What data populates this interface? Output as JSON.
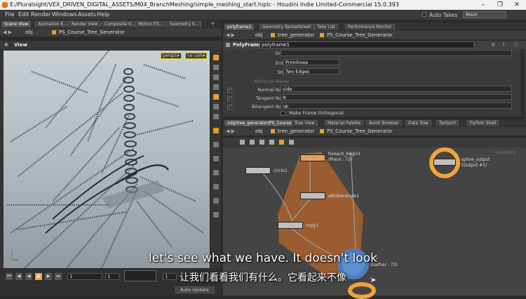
{
  "window": {
    "title": "E:/Pluralsight/VEX_DRIVEN_DIGITAL_ASSETS/M04_BranchMeshing/simple_meshing_start.hiplc - Houdini Indie Limited-Commercial 15.0.393",
    "controls": [
      "–",
      "❐",
      "✕"
    ]
  },
  "menu": {
    "items": [
      "File",
      "Edit",
      "Render",
      "Windows",
      "Assets",
      "Help"
    ],
    "auto_takes": "Auto Takes",
    "desktop": "Main"
  },
  "left_tabs": [
    "Scene View",
    "Animation E...",
    "Render View",
    "Composite V...",
    "Motion FX...",
    "Geometry S..."
  ],
  "left_path": {
    "context": "obj",
    "node": "PS_Course_Tree_Generator"
  },
  "viewport": {
    "label": "View",
    "camera": "persp1▾",
    "nocam": "no cam▾"
  },
  "playbar": {
    "frame": "1",
    "start": "1",
    "end": "1"
  },
  "statusbar": {
    "auto_update": "Auto Update"
  },
  "params_tabs": [
    "polyframe1",
    "Geometry Spreadsheet",
    "Take List",
    "Performance Monitor"
  ],
  "params_path": {
    "context": "obj",
    "node1": "tree_generator",
    "node2": "PS_Course_Tree_Generator"
  },
  "params": {
    "node_type": "PolyFrame",
    "node_name": "polyframe1",
    "group_label": "Group",
    "group_value": "",
    "entity_label": "Entity",
    "entity_value": "Primitives",
    "style_label": "Style",
    "style_value": "Two Edges",
    "attrname_label": "Attribute Name",
    "normal_label": "Normal Name",
    "normal_value": "side",
    "tangent_label": "Tangent Name",
    "tangent_value": "N",
    "bitangent_label": "Bitangent Name",
    "bitangent_value": "up",
    "orthogonal_label": "Make Frame Orthogonal"
  },
  "network_tabs": [
    "/obj/tree_generator/PS_Course_T...",
    "Tree View",
    "Material Palette",
    "Asset Browser",
    "Data Tree",
    "Textport",
    "Python Shell"
  ],
  "network_path": {
    "context": "obj",
    "node1": "tree_generator",
    "node2": "PS_Course_Tree_Generator"
  },
  "nodes": {
    "foreach_begin": "foreach_begin1",
    "foreach_sub": "(Piece : 72)",
    "circle": "circle1",
    "attribwrangle": "attribwrangle1",
    "copy": "copy1",
    "spline_output": "spline_output",
    "spline_sub": "(Output #1)",
    "foreach_end_sub": "(Gather : 73)",
    "foreach_end": "d1",
    "geometry_label": "Geometry"
  },
  "subtitles": {
    "en": "let's see what we have. It doesn't look",
    "zh": "让我们看看我们有什么。它看起来不像"
  },
  "colors": {
    "accent": "#f2a33c",
    "selection": "#d9c300"
  }
}
